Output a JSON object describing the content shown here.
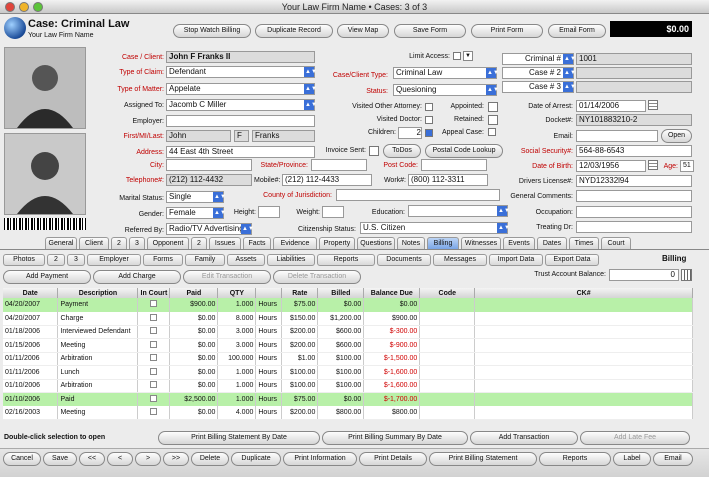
{
  "window": {
    "title": "Your Law Firm Name  •  Cases: 3 of 3"
  },
  "header": {
    "case_title": "Case:  Criminal Law",
    "firm": "Your Law Firm Name",
    "total": "$0.00",
    "buttons": [
      "Stop Watch Billing",
      "Duplicate Record",
      "View Map",
      "Save Form",
      "Print Form",
      "Email Form"
    ]
  },
  "left": {
    "case_client_label": "Case / Client:",
    "case_client": "John F Franks II",
    "type_claim_label": "Type of Claim:",
    "type_claim": "Defendant",
    "type_matter_label": "Type of Matter:",
    "type_matter": "Appelate",
    "assigned_label": "Assigned To:",
    "assigned": "Jacomb C Miller",
    "employer_label": "Employer:",
    "employer": "",
    "name_label": "First/MI/Last:",
    "first": "John",
    "mi": "F",
    "last": "Franks",
    "address_label": "Address:",
    "address": "44 East 4th Street",
    "city_label": "City:",
    "city": "",
    "telephone_label": "Telephone#:",
    "telephone": "(212) 112-4432",
    "marital_label": "Marital Status:",
    "marital": "Single",
    "gender_label": "Gender:",
    "gender": "Female",
    "referred_label": "Referred By:",
    "referred": "Radio/TV Advertising",
    "height_label": "Height:",
    "weight_label": "Weight:"
  },
  "mid": {
    "limit_label": "Limit Access:",
    "case_type_label": "Case/Client Type:",
    "case_type": "Criminal Law",
    "status_label": "Status:",
    "status": "Quesioning",
    "visited_atty": "Visited Other Attorney:",
    "visited_doc": "Visited Doctor:",
    "children_label": "Children:",
    "children": "2",
    "appointed": "Appointed:",
    "retained": "Retained:",
    "appeal": "Appeal Case:",
    "invoice_label": "Invoice Sent:",
    "todos": "ToDos",
    "postal_lookup": "Postal Code Lookup",
    "state_label": "State/Province:",
    "postcode_label": "Post Code:",
    "mobile_label": "Mobile#:",
    "mobile": "(212) 112-4433",
    "work_label": "Work#:",
    "work": "(800) 112-3311",
    "county_label": "County of Jurisdiction:",
    "education_label": "Education:",
    "citizenship_label": "Citizenship Status:",
    "citizenship": "U.S. Citizen"
  },
  "right": {
    "criminal_label": "Criminal #",
    "criminal": "1001",
    "case2_label": "Case # 2",
    "case3_label": "Case # 3",
    "arrest_label": "Date of Arrest:",
    "arrest": "01/14/2006",
    "docket_label": "Docket#:",
    "docket": "NY101883210-2",
    "email_label": "Email:",
    "open": "Open",
    "ss_label": "Social Security#:",
    "ss": "564-88-6543",
    "dob_label": "Date of Birth:",
    "dob": "12/03/1956",
    "age_label": "Age:",
    "age": "51",
    "dl_label": "Drivers License#:",
    "dl": "NYD12332l94",
    "general_label": "General Comments:",
    "occupation_label": "Occupation:",
    "treating_label": "Treating Dr:"
  },
  "tabs": [
    "General",
    "Client",
    "2",
    "3",
    "Opponent",
    "2",
    "Issues",
    "Facts",
    "Evidence",
    "Property",
    "Questions",
    "Notes",
    "Billing",
    "Witnesses",
    "Events",
    "Dates",
    "Times",
    "Court"
  ],
  "subtabs": [
    "Photos",
    "2",
    "3",
    "Employer",
    "Forms",
    "Family",
    "Assets",
    "Liabilities",
    "Reports",
    "Documents",
    "Messages",
    "Import Data",
    "Export Data"
  ],
  "billing": {
    "section": "Billing",
    "add_payment": "Add Payment",
    "add_charge": "Add Charge",
    "edit_transaction": "Edit Transaction",
    "delete_transaction": "Delete Transaction",
    "trust_label": "Trust Account Balance:",
    "trust": "0",
    "columns": [
      "Date",
      "Description",
      "In Court",
      "Paid",
      "QTY",
      "",
      "Rate",
      "Billed",
      "Balance Due",
      "Code",
      "CK#"
    ],
    "rows": [
      {
        "date": "04/20/2007",
        "desc": "Payment",
        "paid": "$900.00",
        "qty": "1.000",
        "unit": "Hours",
        "rate": "$75.00",
        "billed": "$0.00",
        "bal": "$0.00",
        "hl": true,
        "neg": false
      },
      {
        "date": "04/20/2007",
        "desc": "Charge",
        "paid": "$0.00",
        "qty": "8.000",
        "unit": "Hours",
        "rate": "$150.00",
        "billed": "$1,200.00",
        "bal": "$900.00",
        "hl": false,
        "neg": false
      },
      {
        "date": "01/18/2006",
        "desc": "Interviewed Defendant",
        "paid": "$0.00",
        "qty": "3.000",
        "unit": "Hours",
        "rate": "$200.00",
        "billed": "$600.00",
        "bal": "$-300.00",
        "hl": false,
        "neg": true
      },
      {
        "date": "01/15/2006",
        "desc": "Meeting",
        "paid": "$0.00",
        "qty": "3.000",
        "unit": "Hours",
        "rate": "$200.00",
        "billed": "$600.00",
        "bal": "$-900.00",
        "hl": false,
        "neg": true
      },
      {
        "date": "01/11/2006",
        "desc": "Arbitration",
        "paid": "$0.00",
        "qty": "100.000",
        "unit": "Hours",
        "rate": "$1.00",
        "billed": "$100.00",
        "bal": "$-1,500.00",
        "hl": false,
        "neg": true
      },
      {
        "date": "01/11/2006",
        "desc": "Lunch",
        "paid": "$0.00",
        "qty": "1.000",
        "unit": "Hours",
        "rate": "$100.00",
        "billed": "$100.00",
        "bal": "$-1,600.00",
        "hl": false,
        "neg": true
      },
      {
        "date": "01/10/2006",
        "desc": "Arbitration",
        "paid": "$0.00",
        "qty": "1.000",
        "unit": "Hours",
        "rate": "$100.00",
        "billed": "$100.00",
        "bal": "$-1,600.00",
        "hl": false,
        "neg": true
      },
      {
        "date": "01/10/2006",
        "desc": "Paid",
        "paid": "$2,500.00",
        "qty": "1.000",
        "unit": "Hours",
        "rate": "$75.00",
        "billed": "$0.00",
        "bal": "$-1,700.00",
        "hl": true,
        "neg": true
      },
      {
        "date": "02/16/2003",
        "desc": "Meeting",
        "paid": "$0.00",
        "qty": "4.000",
        "unit": "Hours",
        "rate": "$200.00",
        "billed": "$800.00",
        "bal": "$800.00",
        "hl": false,
        "neg": false
      }
    ],
    "hint": "Double-click selection to open",
    "print_statement": "Print Billing Statement By Date",
    "print_summary": "Print Billing Summary By Date",
    "add_transaction": "Add Transaction",
    "add_late_fee": "Add Late Fee"
  },
  "footer": [
    "Cancel",
    "Save",
    "<<",
    "<",
    ">",
    ">>",
    "Delete",
    "Duplicate",
    "Print Information",
    "Print Details",
    "Print Billing Statement",
    "Reports",
    "Label",
    "Email"
  ]
}
